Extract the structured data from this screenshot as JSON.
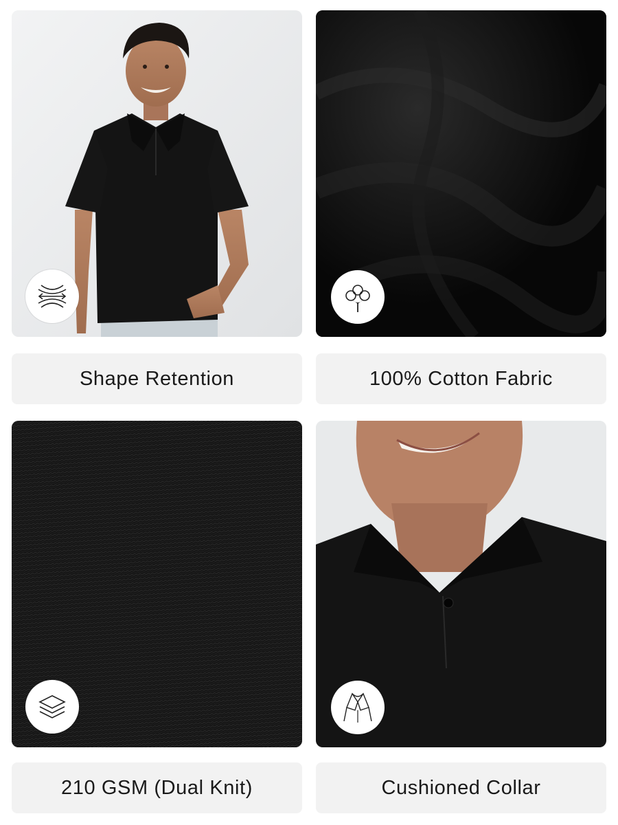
{
  "features": [
    {
      "label": "Shape Retention",
      "icon": "stretch-arrows-icon"
    },
    {
      "label": "100% Cotton Fabric",
      "icon": "cotton-flower-icon"
    },
    {
      "label": "210 GSM (Dual Knit)",
      "icon": "layers-icon"
    },
    {
      "label": "Cushioned Collar",
      "icon": "collar-icon"
    }
  ],
  "colors": {
    "label_bg": "#f2f2f2",
    "shirt": "#121212",
    "photo_bg": "#e9ebec"
  }
}
